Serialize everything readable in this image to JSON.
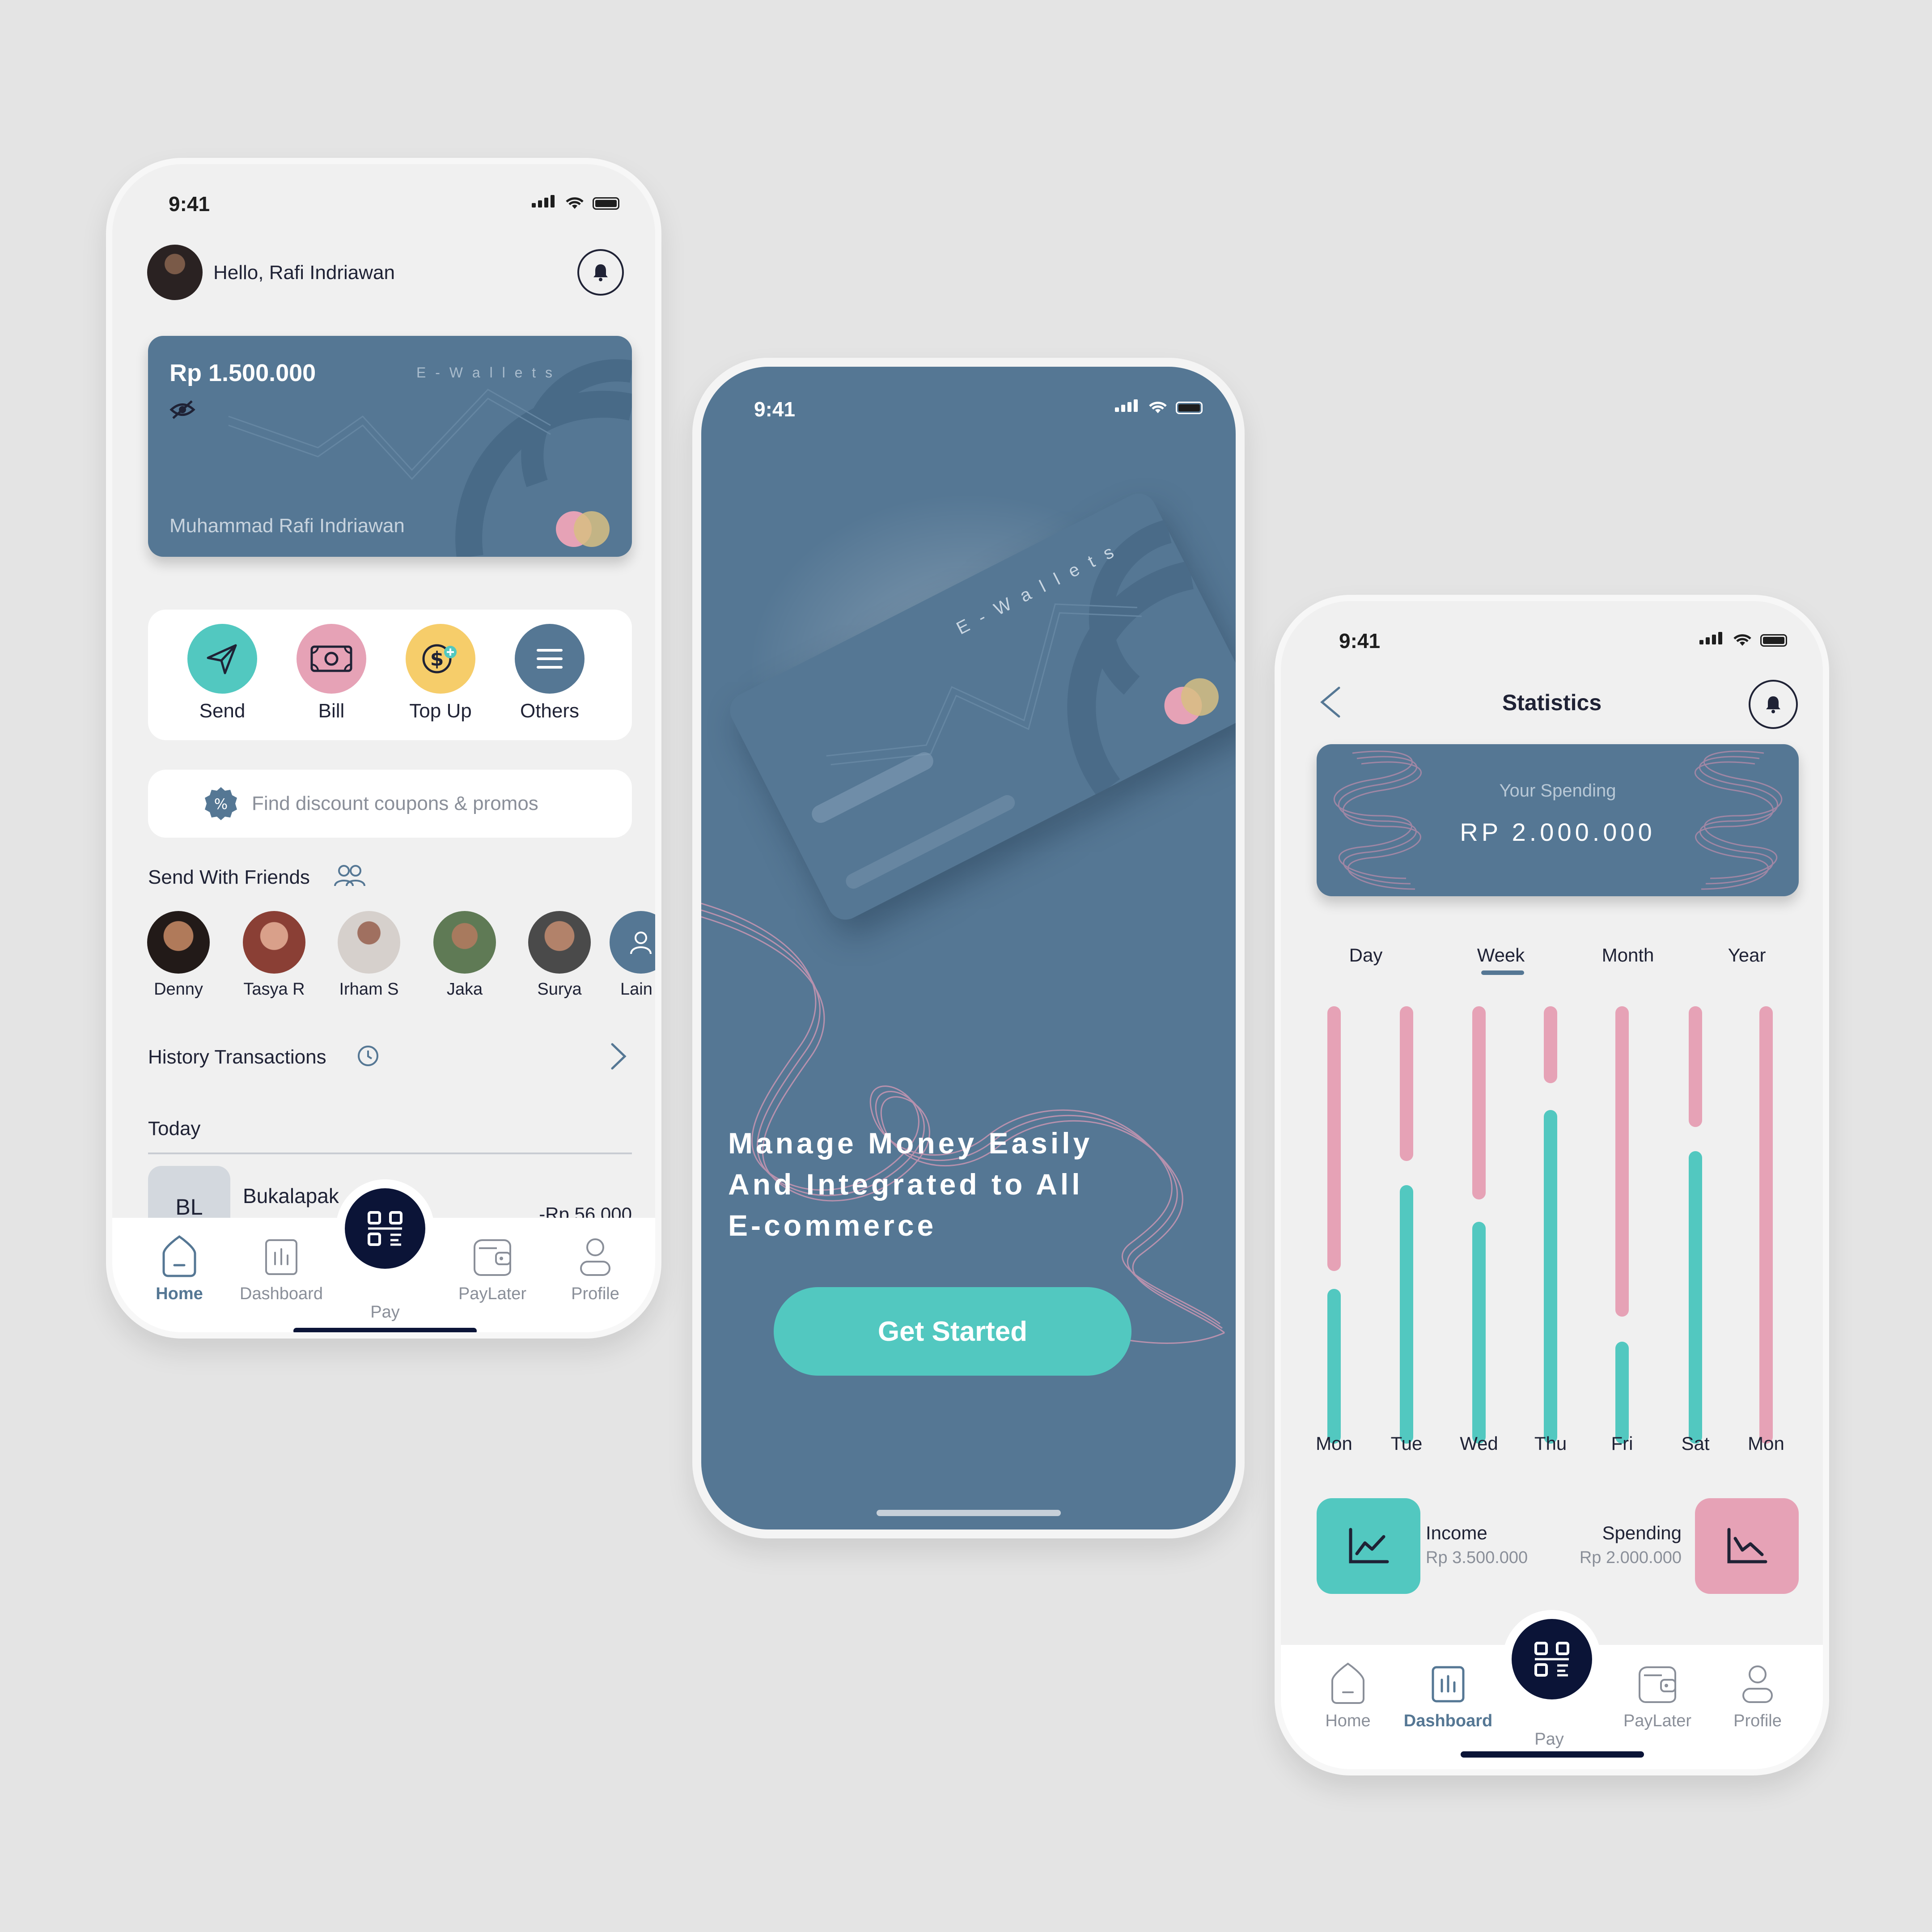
{
  "status_time": "9:41",
  "home_screen": {
    "greeting": "Hello, Rafi Indriawan",
    "card": {
      "balance": "Rp 1.500.000",
      "brand": "E - W a l l e t s",
      "holder": "Muhammad Rafi Indriawan"
    },
    "actions": [
      {
        "label": "Send",
        "color": "#52c8c0"
      },
      {
        "label": "Bill",
        "color": "#e6a2b6"
      },
      {
        "label": "Top Up",
        "color": "#f6cd6a"
      },
      {
        "label": "Others",
        "color": "#557794"
      }
    ],
    "search_placeholder": "Find discount coupons & promos",
    "friends_title": "Send With Friends",
    "friends": [
      "Denny",
      "Tasya R",
      "Irham S",
      "Jaka",
      "Surya",
      "Lain"
    ],
    "history_title": "History Transactions",
    "today_label": "Today",
    "transaction": {
      "initials": "BL",
      "merchant": "Bukalapak",
      "amount": "-Rp 56.000"
    }
  },
  "nav": {
    "items": [
      "Home",
      "Dashboard",
      "Pay",
      "PayLater",
      "Profile"
    ]
  },
  "onboarding": {
    "card_brand": "E - W a l l e t s",
    "headline_1": "Manage Money Easily",
    "headline_2": "And Integrated to All",
    "headline_3": "E-commerce",
    "cta": "Get Started"
  },
  "statistics": {
    "title": "Statistics",
    "spending_label": "Your Spending",
    "spending_value": "RP 2.000.000",
    "tabs": [
      "Day",
      "Week",
      "Month",
      "Year"
    ],
    "active_tab": "Week",
    "days": [
      "Mon",
      "Tue",
      "Wed",
      "Thu",
      "Fri",
      "Sat",
      "Mon"
    ],
    "income_label": "Income",
    "income_value": "Rp 3.500.000",
    "spending_sum_label": "Spending",
    "spending_sum_value": "Rp 2.000.000",
    "colors": {
      "income": "#52c8c0",
      "spending": "#e6a2b6",
      "accent": "#557794",
      "dark": "#0b1437"
    }
  }
}
